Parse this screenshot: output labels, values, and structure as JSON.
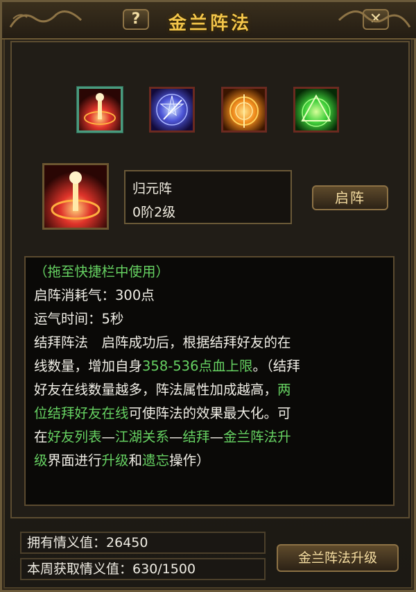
{
  "window": {
    "title": "金兰阵法",
    "help_label": "?",
    "close_label": "✕"
  },
  "formations": {
    "icons": [
      {
        "name": "归元阵",
        "icon": "red-fire-pillar-icon",
        "color": "#e0342a"
      },
      {
        "name": "",
        "icon": "blue-star-sigil-icon",
        "color": "#4d56d8"
      },
      {
        "name": "",
        "icon": "orange-sun-sigil-icon",
        "color": "#f08b1c"
      },
      {
        "name": "",
        "icon": "green-triangle-sigil-icon",
        "color": "#3fcf3a"
      }
    ]
  },
  "selected": {
    "name": "归元阵",
    "level": "0阶2级",
    "activate_label": "启阵"
  },
  "description": {
    "drag_hint": "（拖至快捷栏中使用）",
    "cost_line": "启阵消耗气：300点",
    "time_line": "运气时间：5秒",
    "p1": "结拜阵法　启阵成功后，根据结拜好友的在",
    "p2a": "线数量，增加自身",
    "p2_highlight": "358-536点血上限",
    "p2b": "。（结拜",
    "p3a": "好友在线数量越多，阵法属性加成越高，",
    "p3_highlight": "两",
    "p4_highlight": "位结拜好友在线",
    "p4b": "可使阵法的效果最大化。可",
    "p5a": "在",
    "p5_h1": "好友列表",
    "p5_s1": "—",
    "p5_h2": "江湖关系",
    "p5_s2": "—",
    "p5_h3": "结拜",
    "p5_s3": "—",
    "p5_h4": "金兰阵法升",
    "p6_h1": "级",
    "p6_a": "界面进行",
    "p6_h2": "升级",
    "p6_b": "和",
    "p6_h3": "遗忘",
    "p6_c": "操作）"
  },
  "stats": {
    "owned_label": "拥有情义值：",
    "owned_value": "26450",
    "weekly_label": "本周获取情义值：",
    "weekly_value": "630/1500",
    "upgrade_label": "金兰阵法升级"
  },
  "colors": {
    "accent_gold": "#f4c64a",
    "highlight_green": "#66d262",
    "text": "#f1efe7"
  }
}
